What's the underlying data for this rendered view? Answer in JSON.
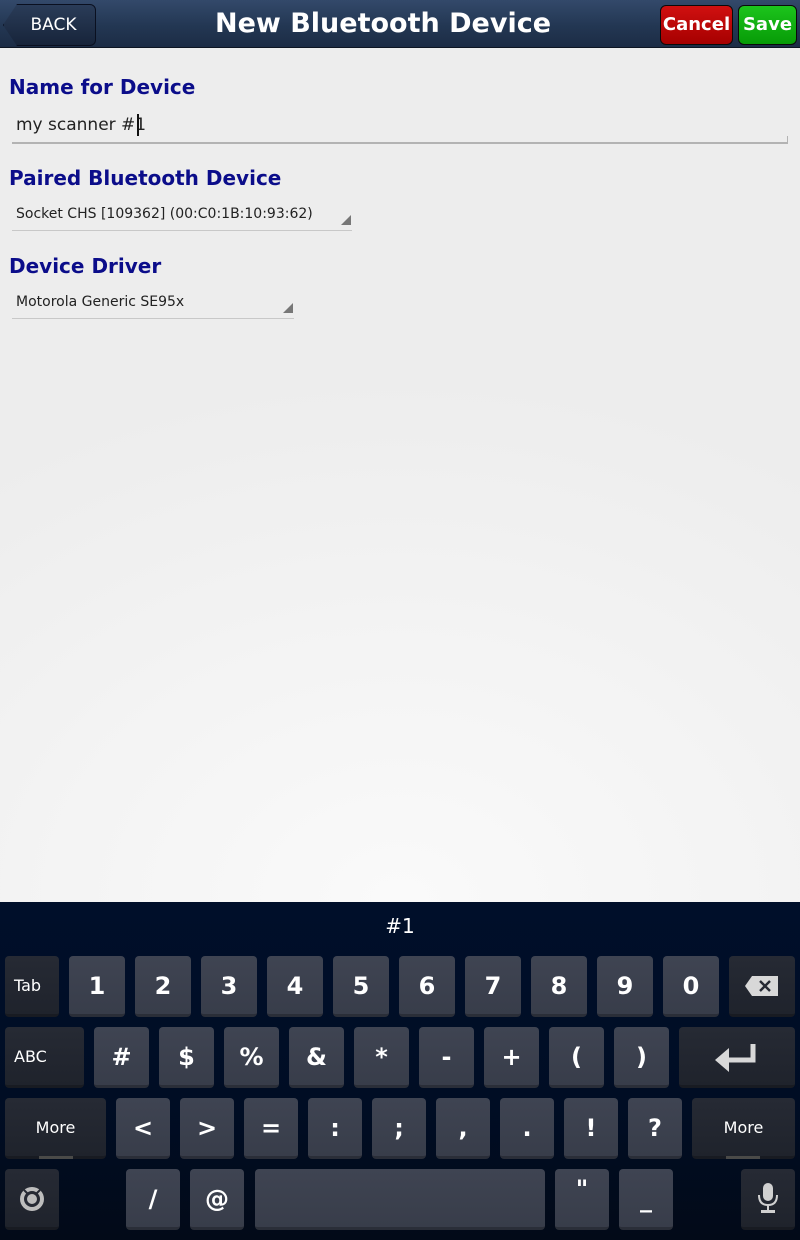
{
  "header": {
    "back_label": "BACK",
    "title": "New Bluetooth Device",
    "cancel_label": "Cancel",
    "save_label": "Save",
    "colors": {
      "cancel": "#c00000",
      "save": "#10b010",
      "bar": "#233753"
    }
  },
  "form": {
    "name_label": "Name for Device",
    "name_value": "my scanner #1",
    "paired_label": "Paired Bluetooth Device",
    "paired_value": "Socket CHS [109362] (00:C0:1B:10:93:62)",
    "driver_label": "Device Driver",
    "driver_value": "Motorola Generic SE95x",
    "label_color": "#0b0d8a"
  },
  "keyboard": {
    "candidate": "#1",
    "row1": {
      "tab": "Tab",
      "keys": [
        "1",
        "2",
        "3",
        "4",
        "5",
        "6",
        "7",
        "8",
        "9",
        "0"
      ],
      "backspace_icon": "backspace-icon"
    },
    "row2": {
      "abc": "ABC",
      "keys": [
        "#",
        "$",
        "%",
        "&",
        "*",
        "-",
        "+",
        "(",
        ")"
      ],
      "enter_icon": "enter-icon"
    },
    "row3": {
      "more_left": "More",
      "keys": [
        "<",
        ">",
        "=",
        ":",
        ";",
        ",",
        ".",
        "!",
        "?"
      ],
      "more_right": "More"
    },
    "row4": {
      "settings_icon": "settings-icon",
      "keys_left": [
        "/",
        "@"
      ],
      "space_label": "",
      "keys_right": [
        "\"",
        "_"
      ],
      "mic_icon": "microphone-icon"
    }
  }
}
